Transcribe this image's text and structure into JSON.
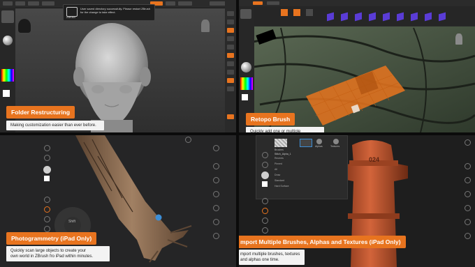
{
  "panels": {
    "folder": {
      "title": "Folder Restructuring",
      "caption": "Making customization easier than ever before.",
      "popup_text": "ZBrush",
      "popup_desc": "User saved directory successfully. Please restart ZBrush for the change to take effect."
    },
    "retopo": {
      "title": "Retopo Brush",
      "caption": "Quickly add one or multiple"
    },
    "photogrammetry": {
      "title": "Photogrammetry (iPad Only)",
      "caption_line1": "Quickly scan large objects to create your",
      "caption_line2": "own world in ZBrush fro iPad within minutes.",
      "shift_label": "Shift"
    },
    "import": {
      "title": "mport Multiple Brushes, Alphas and Textures (iPad Only)",
      "caption_line1": "mport multiple brushes, textures",
      "caption_line2": "and alphas one time.",
      "hydrant_text": "024",
      "tab_labels": [
        "Brushes",
        "Alphas",
        "Textures"
      ],
      "alpha_name": "Stitch_Alpha_1",
      "menu_items": [
        "Recents",
        "Pinned",
        "All",
        "Draw",
        "Standard",
        "Hard Surface"
      ]
    }
  },
  "colors": {
    "accent": "#e8741f",
    "caption_bg": "#f3f3f3"
  }
}
